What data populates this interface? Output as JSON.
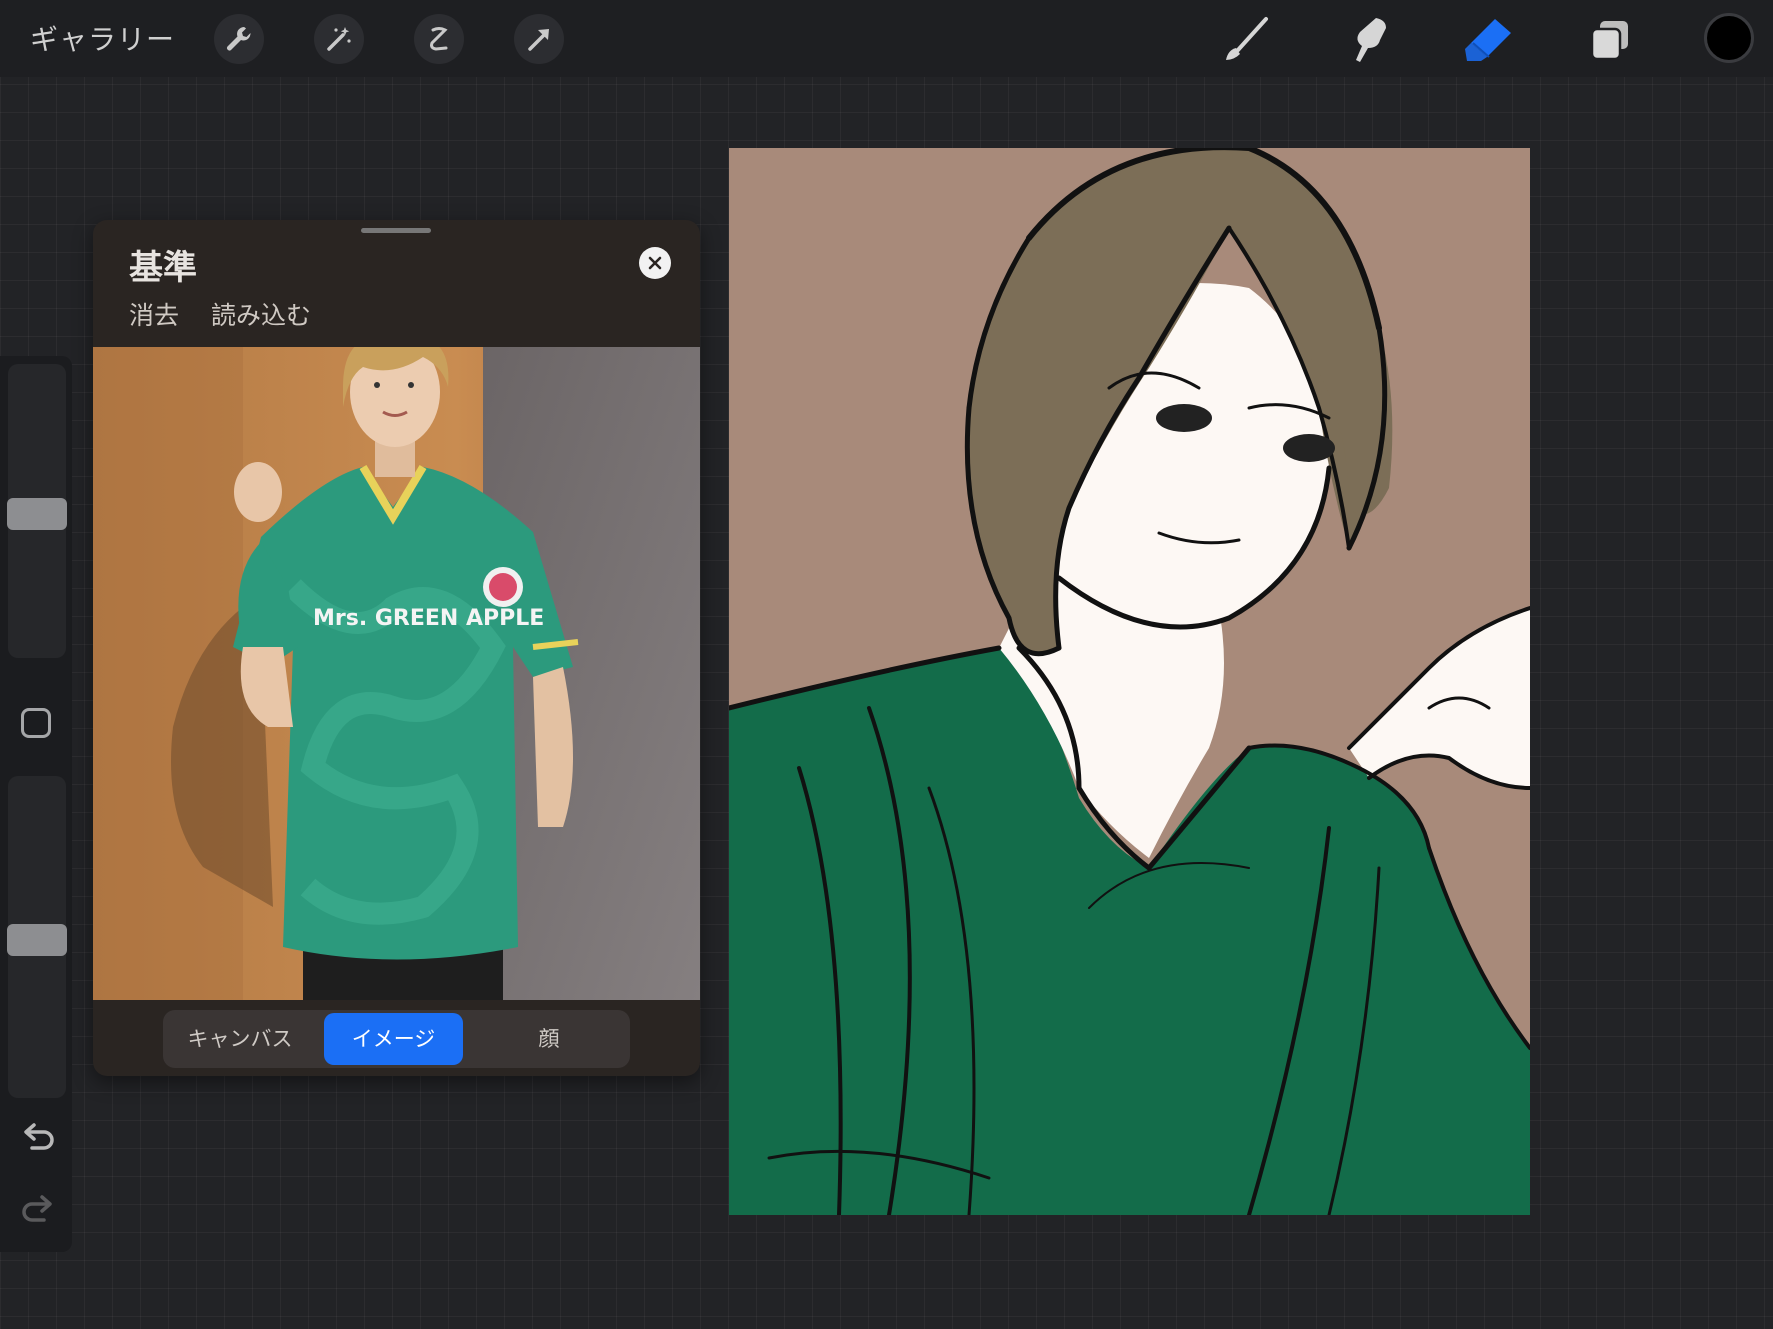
{
  "toolbar": {
    "gallery_label": "ギャラリー",
    "left_tools": [
      "wrench-icon",
      "magic-wand-icon",
      "selection-icon",
      "transform-arrow-icon"
    ],
    "right_tools": [
      "brush-icon",
      "smudge-icon",
      "eraser-icon",
      "layers-icon"
    ],
    "active_tool": "eraser-icon",
    "active_color": "#1b6ff5",
    "current_color": "#000000"
  },
  "sidebar": {
    "brush_size_level": 0.49,
    "opacity_level": 0.49
  },
  "reference": {
    "title": "基準",
    "clear_label": "消去",
    "import_label": "読み込む",
    "photo_text": "Mrs. GREEN APPLE",
    "tabs": [
      {
        "label": "キャンバス",
        "active": false
      },
      {
        "label": "イメージ",
        "active": true
      },
      {
        "label": "顔",
        "active": false
      }
    ]
  },
  "canvas_colors": {
    "background": "#a88a7a",
    "hair": "#7c6e57",
    "skin": "#fdf8f4",
    "shirt": "#136c4a",
    "line": "#111111"
  }
}
